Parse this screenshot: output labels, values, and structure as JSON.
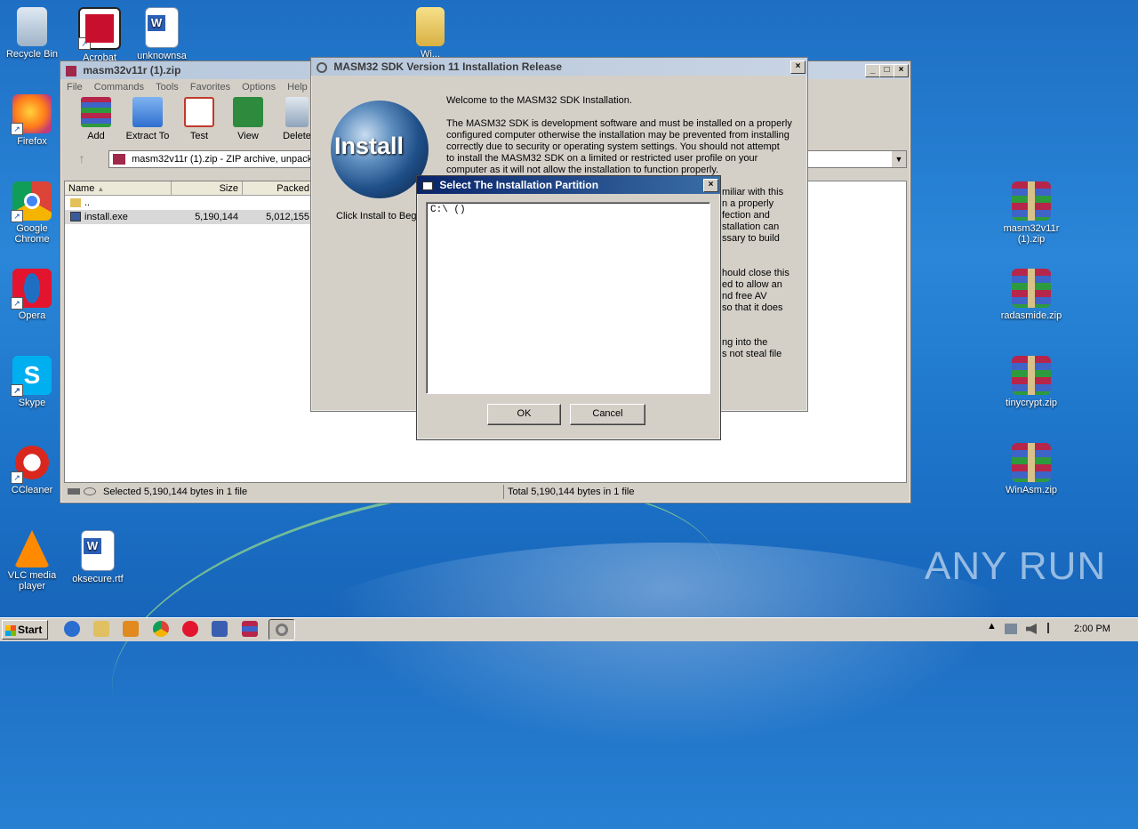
{
  "desktop": {
    "left_icons": [
      {
        "label": "Recycle Bin",
        "icon": "recycle-bin-icon"
      },
      {
        "label": "Acrobat",
        "icon": "acrobat-icon"
      },
      {
        "label": "unknownsa",
        "icon": "word-document-icon"
      },
      {
        "label": "Wi...",
        "icon": "folder-icon"
      },
      {
        "label": "Firefox",
        "icon": "firefox-icon"
      },
      {
        "label": "Google Chrome",
        "icon": "chrome-icon"
      },
      {
        "label": "Opera",
        "icon": "opera-icon"
      },
      {
        "label": "Skype",
        "icon": "skype-icon"
      },
      {
        "label": "CCleaner",
        "icon": "ccleaner-icon"
      },
      {
        "label": "VLC media player",
        "icon": "vlc-icon"
      },
      {
        "label": "oksecure.rtf",
        "icon": "word-document-icon"
      }
    ],
    "right_icons": [
      {
        "label": "masm32v11r (1).zip",
        "icon": "winrar-archive-icon"
      },
      {
        "label": "radasmide.zip",
        "icon": "winrar-archive-icon"
      },
      {
        "label": "tinycrypt.zip",
        "icon": "winrar-archive-icon"
      },
      {
        "label": "WinAsm.zip",
        "icon": "winrar-archive-icon"
      }
    ],
    "watermark": "ANY RUN"
  },
  "winrar": {
    "title": "masm32v11r (1).zip",
    "menu": [
      "File",
      "Commands",
      "Tools",
      "Favorites",
      "Options",
      "Help"
    ],
    "toolbar": [
      "Add",
      "Extract To",
      "Test",
      "View",
      "Delete"
    ],
    "address": "masm32v11r (1).zip - ZIP archive, unpacke",
    "columns": {
      "name": "Name",
      "size": "Size",
      "packed": "Packed"
    },
    "rows": [
      {
        "name": "..",
        "size": "",
        "packed": ""
      },
      {
        "name": "install.exe",
        "size": "5,190,144",
        "packed": "5,012,155"
      }
    ],
    "status_left": "Selected 5,190,144 bytes in 1 file",
    "status_right": "Total 5,190,144 bytes in 1 file"
  },
  "installer": {
    "title": "MASM32 SDK Version 11 Installation Release",
    "logo_text": "Install",
    "caption": "Click Install to Begi",
    "welcome": "Welcome to the MASM32 SDK Installation.",
    "para1_lines": [
      "The MASM32 SDK is development software and must be installed on a properly",
      "configured computer otherwise the installation may be prevented from installing",
      "correctly due to security or operating system settings. You should not attempt",
      "to install the MASM32 SDK on a limited or restricted user profile on your",
      "computer as it will not allow the installation to function properly."
    ],
    "para2_lines": [
      "miliar with this",
      "n a properly",
      "fection and",
      "stallation can",
      "ssary to build"
    ],
    "para3_lines": [
      "hould close this",
      "ed to allow an",
      "nd free AV",
      "so that it does"
    ],
    "para4_lines": [
      "ng into the",
      "s not steal file"
    ]
  },
  "partition_dialog": {
    "title": "Select The Installation Partition",
    "items": [
      "C:\\ ()"
    ],
    "ok": "OK",
    "cancel": "Cancel"
  },
  "taskbar": {
    "start": "Start",
    "clock": "2:00 PM"
  }
}
